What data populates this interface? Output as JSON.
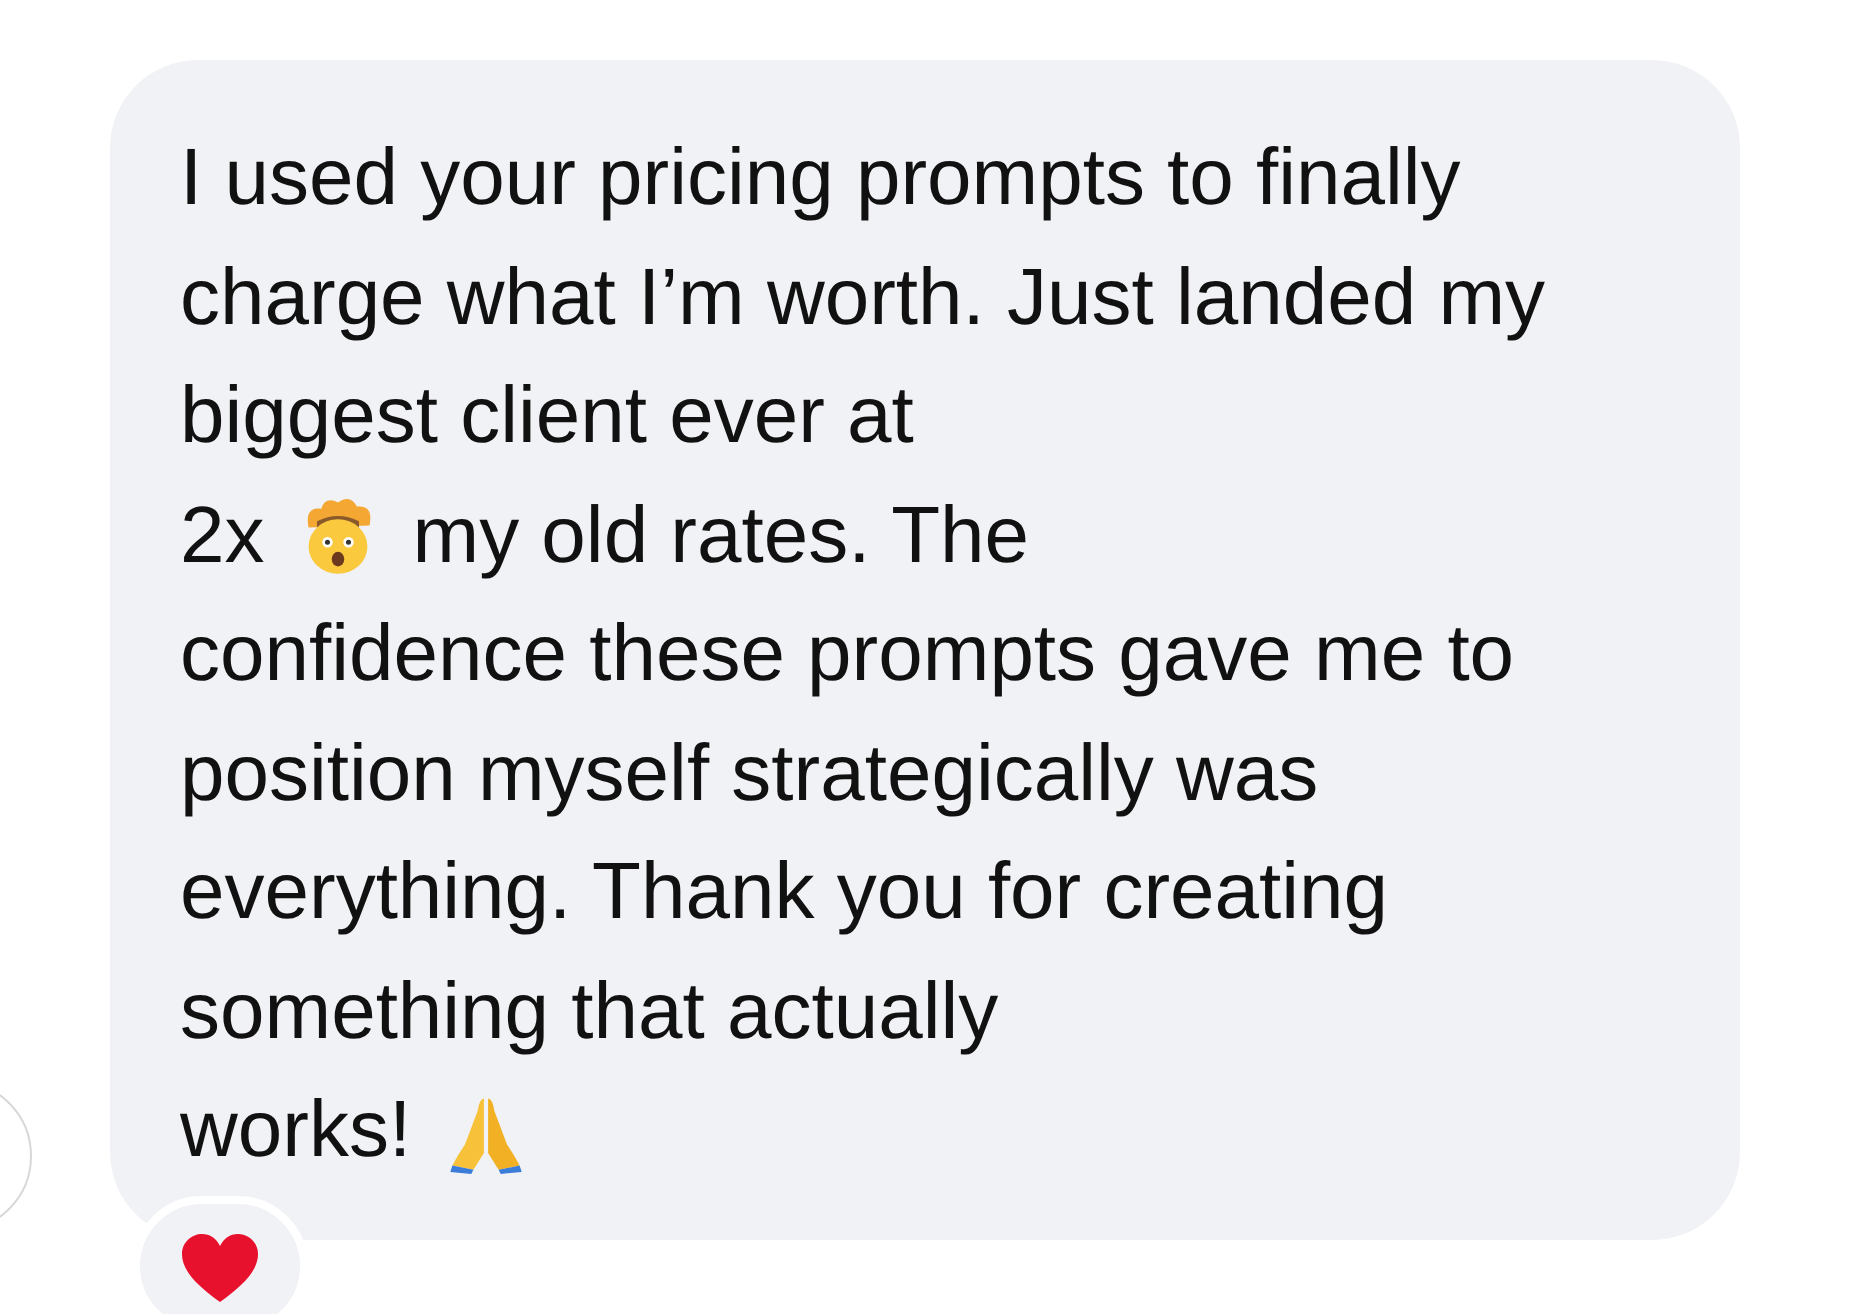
{
  "message": {
    "rows": [
      {
        "parts": [
          {
            "kind": "text",
            "text": "I used your pricing prompts to finally charge what I’m worth. Just landed my biggest client ever at"
          }
        ]
      },
      {
        "parts": [
          {
            "kind": "text",
            "text": "2x"
          },
          {
            "kind": "mind-blown-emoji"
          },
          {
            "kind": "text",
            "text": "my old rates. The"
          }
        ]
      },
      {
        "parts": [
          {
            "kind": "text",
            "text": "confidence these prompts gave me to position myself strategically was everything. Thank you for creating something that actually"
          }
        ]
      },
      {
        "parts": [
          {
            "kind": "text",
            "text": "works!"
          },
          {
            "kind": "praying-hands-emoji"
          }
        ]
      }
    ]
  },
  "reaction": {
    "kind": "heart"
  }
}
